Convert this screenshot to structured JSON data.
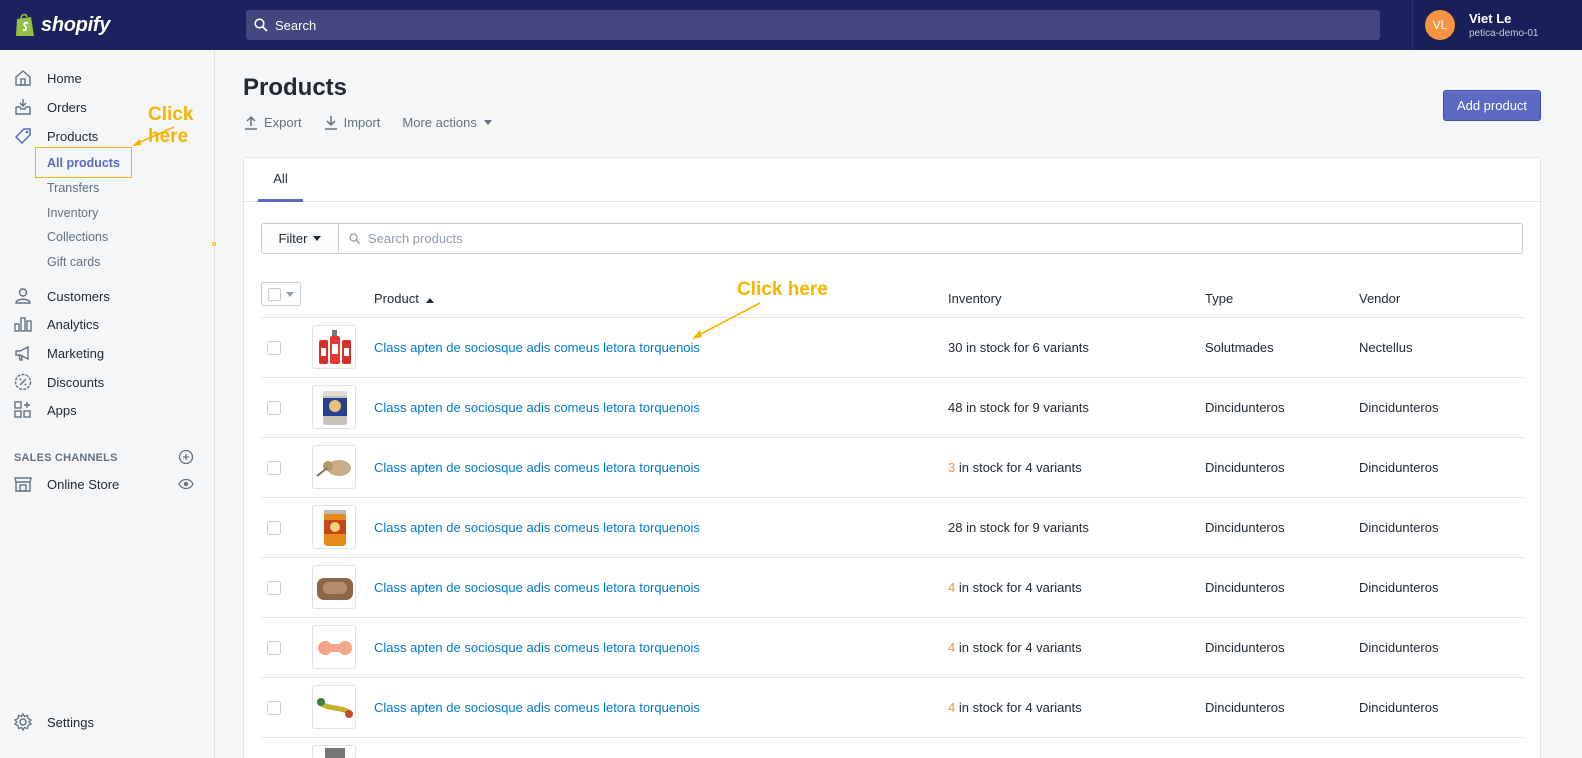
{
  "header": {
    "brand": "shopify",
    "search_placeholder": "Search",
    "user_initials": "VL",
    "user_name": "Viet Le",
    "store_name": "petica-demo-01"
  },
  "sidebar": {
    "items": [
      {
        "label": "Home",
        "icon": "home-icon"
      },
      {
        "label": "Orders",
        "icon": "orders-icon"
      },
      {
        "label": "Products",
        "icon": "tag-icon"
      },
      {
        "label": "Customers",
        "icon": "person-icon"
      },
      {
        "label": "Analytics",
        "icon": "bar-chart-icon"
      },
      {
        "label": "Marketing",
        "icon": "megaphone-icon"
      },
      {
        "label": "Discounts",
        "icon": "discount-icon"
      },
      {
        "label": "Apps",
        "icon": "apps-icon"
      }
    ],
    "product_subitems": [
      "All products",
      "Transfers",
      "Inventory",
      "Collections",
      "Gift cards"
    ],
    "sales_channels_header": "SALES CHANNELS",
    "online_store": "Online Store",
    "settings": "Settings"
  },
  "annotations": {
    "sidebar_hint": "Click here",
    "table_hint": "Click here",
    "color": "#f6b500"
  },
  "main": {
    "title": "Products",
    "actions": [
      "Export",
      "Import",
      "More actions"
    ],
    "add_button": "Add product",
    "tabs": [
      "All"
    ],
    "filter_label": "Filter",
    "search_placeholder": "Search products",
    "columns": [
      "Product",
      "Inventory",
      "Type",
      "Vendor"
    ],
    "rows": [
      {
        "name": "Class apten de sociosque adis comeus letora torquenois",
        "inv_count": "30",
        "inv_rest": " in stock for 6 variants",
        "low": false,
        "type": "Solutmades",
        "vendor": "Nectellus"
      },
      {
        "name": "Class apten de sociosque adis comeus letora torquenois",
        "inv_count": "48",
        "inv_rest": " in stock for 9 variants",
        "low": false,
        "type": "Dincidunteros",
        "vendor": "Dincidunteros"
      },
      {
        "name": "Class apten de sociosque adis comeus letora torquenois",
        "inv_count": "3",
        "inv_rest": " in stock for 4 variants",
        "low": true,
        "type": "Dincidunteros",
        "vendor": "Dincidunteros"
      },
      {
        "name": "Class apten de sociosque adis comeus letora torquenois",
        "inv_count": "28",
        "inv_rest": " in stock for 9 variants",
        "low": false,
        "type": "Dincidunteros",
        "vendor": "Dincidunteros"
      },
      {
        "name": "Class apten de sociosque adis comeus letora torquenois",
        "inv_count": "4",
        "inv_rest": " in stock for 4 variants",
        "low": true,
        "type": "Dincidunteros",
        "vendor": "Dincidunteros"
      },
      {
        "name": "Class apten de sociosque adis comeus letora torquenois",
        "inv_count": "4",
        "inv_rest": " in stock for 4 variants",
        "low": true,
        "type": "Dincidunteros",
        "vendor": "Dincidunteros"
      },
      {
        "name": "Class apten de sociosque adis comeus letora torquenois",
        "inv_count": "4",
        "inv_rest": " in stock for 4 variants",
        "low": true,
        "type": "Dincidunteros",
        "vendor": "Dincidunteros"
      }
    ]
  },
  "colors": {
    "topbar": "#1c2260",
    "accent": "#5c6ac4",
    "link": "#007ace",
    "low_stock": "#f49342"
  }
}
